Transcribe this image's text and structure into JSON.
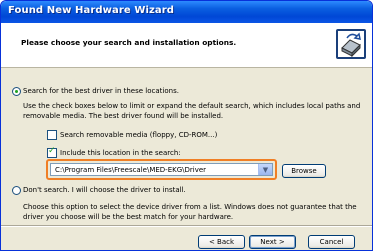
{
  "window": {
    "title": "Found New Hardware Wizard"
  },
  "header": {
    "heading": "Please choose your search and installation options."
  },
  "search_option": {
    "label": "Search for the best driver in these locations.",
    "description": "Use the check boxes below to limit or expand the default search, which includes local paths and removable media. The best driver found will be installed.",
    "removable_media_label": "Search removable media (floppy, CD-ROM...)",
    "include_location_label": "Include this location in the search:",
    "location_value": "C:\\Program Files\\Freescale\\MED-EKG\\Driver",
    "browse_label": "Browse"
  },
  "manual_option": {
    "label": "Don't search. I will choose the driver to install.",
    "description": "Choose this option to select the device driver from a list.  Windows does not guarantee that the driver you choose will be the best match for your hardware."
  },
  "buttons": {
    "back": "< Back",
    "next": "Next >",
    "cancel": "Cancel"
  },
  "icons": {
    "wizard": "hardware-wizard-icon",
    "dropdown": "chevron-down-icon"
  },
  "colors": {
    "titlebar": "#0a5ee0",
    "highlight": "#f07f25",
    "radio_dot": "#21a121"
  }
}
